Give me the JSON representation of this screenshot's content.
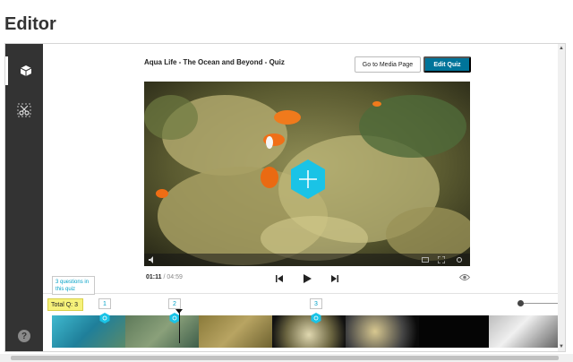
{
  "page": {
    "title": "Editor"
  },
  "sidebar": {
    "items": [
      {
        "name": "quiz-tool",
        "icon": "cube-icon",
        "active": true
      },
      {
        "name": "clip-tool",
        "icon": "scissors-icon",
        "active": false
      }
    ],
    "help_icon": "help-icon",
    "help_label": "?"
  },
  "header": {
    "video_title": "Aqua Life - The Ocean and Beyond - Quiz",
    "media_button": "Go to Media Page",
    "edit_button": "Edit Quiz"
  },
  "player": {
    "current_time": "01:11",
    "duration": "/ 04:59",
    "add_icon": "plus-hexagon-icon"
  },
  "timeline": {
    "tooltip": "3 questions in this quiz",
    "total": "Total Q: 3",
    "markers": [
      "1",
      "2",
      "3"
    ]
  },
  "colors": {
    "sidebar": "#333333",
    "accent": "#00749a",
    "cuepoint": "#1ac3e6",
    "badge": "#f6f27a"
  }
}
